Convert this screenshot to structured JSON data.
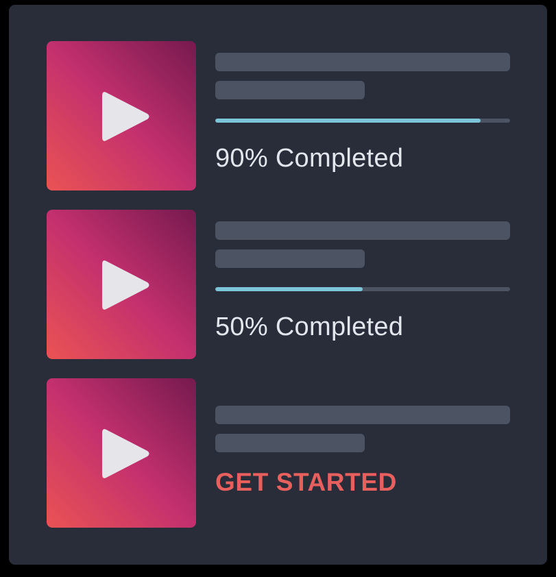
{
  "colors": {
    "page_background": "#000000",
    "card_background": "#282d39",
    "placeholder": "#4c5362",
    "progress_fill": "#7cc5d8",
    "status_text": "#e3e6ec",
    "cta_text": "#e8605e",
    "thumbnail_gradient": [
      "#ea5353",
      "#c3306e",
      "#751a4e"
    ],
    "play_icon": "#e6e6ea"
  },
  "courses": [
    {
      "icon": "play-icon",
      "progress": 0.9,
      "status": "90% Completed"
    },
    {
      "icon": "play-icon",
      "progress": 0.5,
      "status": "50% Completed"
    },
    {
      "icon": "play-icon",
      "cta": "GET STARTED"
    }
  ]
}
